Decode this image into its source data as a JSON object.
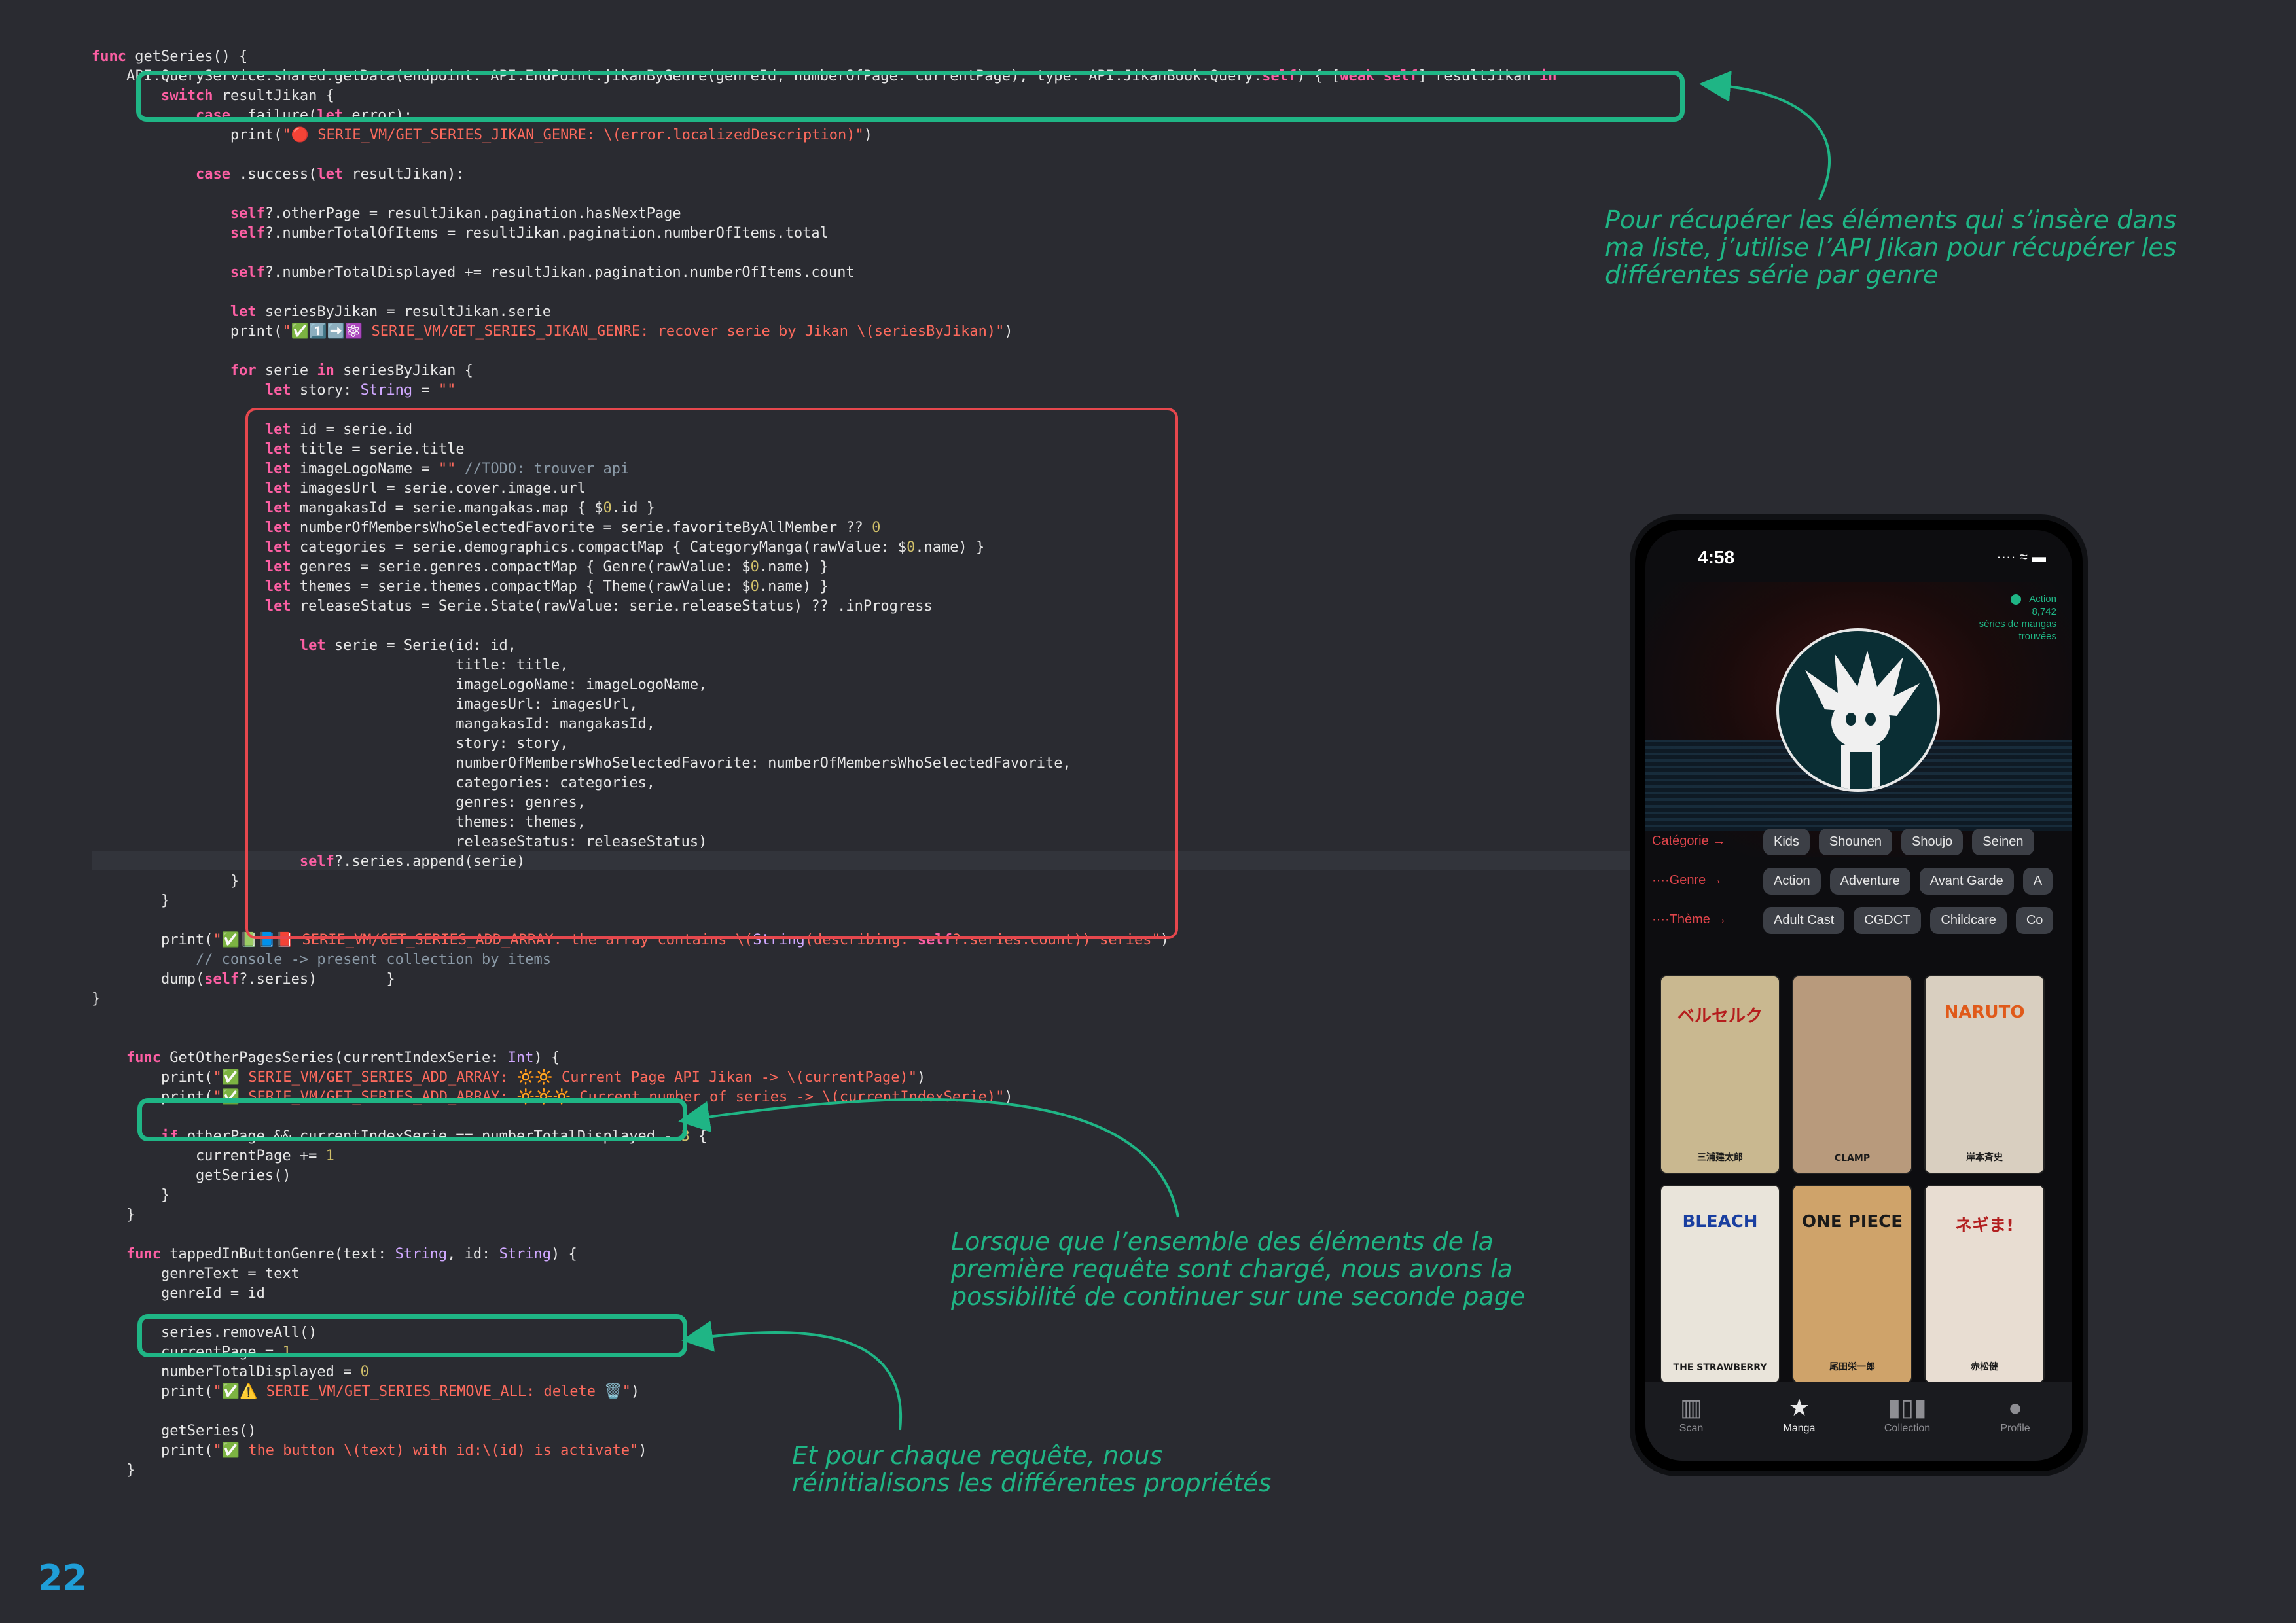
{
  "page_number": "22",
  "code_lines": [
    "func getSeries() {",
    "    API.QueryService.shared.getData(endpoint: API.EndPoint.jikanByGenre(genreId, numberOfPage: currentPage), type: API.JikanBook.Query.self) { [weak self] resultJikan in",
    "        switch resultJikan {",
    "            case .failure(let error):",
    "                print(\"🔴 SERIE_VM/GET_SERIES_JIKAN_GENRE: \\(error.localizedDescription)\")",
    "",
    "            case .success(let resultJikan):",
    "",
    "                self?.otherPage = resultJikan.pagination.hasNextPage",
    "                self?.numberTotalOfItems = resultJikan.pagination.numberOfItems.total",
    "",
    "                self?.numberTotalDisplayed += resultJikan.pagination.numberOfItems.count",
    "",
    "                let seriesByJikan = resultJikan.serie",
    "                print(\"✅1️⃣➡️⚛️ SERIE_VM/GET_SERIES_JIKAN_GENRE: recover serie by Jikan \\(seriesByJikan)\")",
    "",
    "                for serie in seriesByJikan {",
    "                    let story: String = \"\"",
    "",
    "                    let id = serie.id",
    "                    let title = serie.title",
    "                    let imageLogoName = \"\" //TODO: trouver api",
    "                    let imagesUrl = serie.cover.image.url",
    "                    let mangakasId = serie.mangakas.map { $0.id }",
    "                    let numberOfMembersWhoSelectedFavorite = serie.favoriteByAllMember ?? 0",
    "                    let categories = serie.demographics.compactMap { CategoryManga(rawValue: $0.name) }",
    "                    let genres = serie.genres.compactMap { Genre(rawValue: $0.name) }",
    "                    let themes = serie.themes.compactMap { Theme(rawValue: $0.name) }",
    "                    let releaseStatus = Serie.State(rawValue: serie.releaseStatus) ?? .inProgress",
    "",
    "                        let serie = Serie(id: id,",
    "                                          title: title,",
    "                                          imageLogoName: imageLogoName,",
    "                                          imagesUrl: imagesUrl,",
    "                                          mangakasId: mangakasId,",
    "                                          story: story,",
    "                                          numberOfMembersWhoSelectedFavorite: numberOfMembersWhoSelectedFavorite,",
    "                                          categories: categories,",
    "                                          genres: genres,",
    "                                          themes: themes,",
    "                                          releaseStatus: releaseStatus)",
    "                        self?.series.append(serie)",
    "                }",
    "        }",
    "",
    "        print(\"✅📗📘📕 SERIE_VM/GET_SERIES_ADD_ARRAY: the array contains \\(String(describing: self?.series.count)) series\")",
    "            // console -> present collection by items",
    "        dump(self?.series)        }",
    "}",
    "",
    "",
    "    func GetOtherPagesSeries(currentIndexSerie: Int) {",
    "        print(\"✅ SERIE_VM/GET_SERIES_ADD_ARRAY: 🔆🔆 Current Page API Jikan -> \\(currentPage)\")",
    "        print(\"✅ SERIE_VM/GET_SERIES_ADD_ARRAY: 🔆🔆🔆 Current number of series -> \\(currentIndexSerie)\")",
    "",
    "        if otherPage && currentIndexSerie == numberTotalDisplayed - 3 {",
    "            currentPage += 1",
    "            getSeries()",
    "        }",
    "    }",
    "",
    "    func tappedInButtonGenre(text: String, id: String) {",
    "        genreText = text",
    "        genreId = id",
    "",
    "        series.removeAll()",
    "        currentPage = 1",
    "        numberTotalDisplayed = 0",
    "        print(\"✅⚠️ SERIE_VM/GET_SERIES_REMOVE_ALL: delete 🗑️\")",
    "",
    "        getSeries()",
    "        print(\"✅ the button \\(text) with id:\\(id) is activate\")",
    "    }"
  ],
  "annotations": {
    "top_right": "Pour récupérer les éléments qui s’insère dans ma liste, j’utilise l’API Jikan pour récupérer les différentes série par genre",
    "middle": "Lorsque que l’ensemble des éléments de la première requête sont chargé, nous avons la possibilité de continuer sur une seconde page",
    "bottom": "Et pour chaque requête, nous réinitialisons les différentes propriétés"
  },
  "phone": {
    "time": "4:58",
    "status_icons": "···· ≈ ▬",
    "badge": {
      "label": "Action",
      "count": "8,742",
      "caption": "séries de mangas trouvées"
    },
    "filter_rows": [
      {
        "label": "Catégorie →",
        "chips": [
          "Kids",
          "Shounen",
          "Shoujo",
          "Seinen"
        ]
      },
      {
        "label": "····Genre →",
        "chips": [
          "Action",
          "Adventure",
          "Avant Garde",
          "A"
        ]
      },
      {
        "label": "····Thème →",
        "chips": [
          "Adult Cast",
          "CGDCT",
          "Childcare",
          "Co"
        ]
      }
    ],
    "covers": [
      {
        "title": "ベルセルク",
        "sub": "三浦建太郎",
        "bg": "#c9b890",
        "fg": "#b51d1d"
      },
      {
        "title": "",
        "sub": "CLAMP",
        "bg": "#b89a7c",
        "fg": "#3a2a1f"
      },
      {
        "title": "NARUTO",
        "sub": "岸本斉史",
        "bg": "#d9cfc0",
        "fg": "#e05a1a"
      },
      {
        "title": "BLEACH",
        "sub": "THE STRAWBERRY",
        "bg": "#e9e4da",
        "fg": "#1a3fa0"
      },
      {
        "title": "ONE PIECE",
        "sub": "尾田栄一郎",
        "bg": "#cfa36a",
        "fg": "#1a1a1a"
      },
      {
        "title": "ネギま!",
        "sub": "赤松健",
        "bg": "#e8ddd2",
        "fg": "#b32020"
      }
    ],
    "tabs": [
      {
        "label": "Scan",
        "icon": "barcode-icon",
        "glyph": "▥"
      },
      {
        "label": "Manga",
        "icon": "star-icon",
        "glyph": "★"
      },
      {
        "label": "Collection",
        "icon": "books-icon",
        "glyph": "▮▯▮"
      },
      {
        "label": "Profile",
        "icon": "person-icon",
        "glyph": "●"
      }
    ]
  }
}
